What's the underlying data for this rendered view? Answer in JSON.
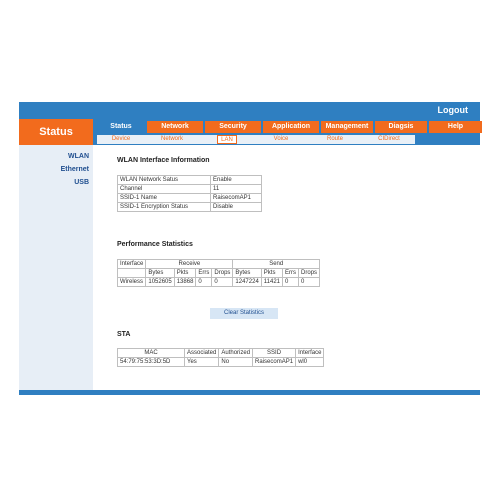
{
  "header": {
    "logout_label": "Logout",
    "status_label": "Status"
  },
  "nav": {
    "main": [
      "Status",
      "Network",
      "Security",
      "Application",
      "Management",
      "Diagsis",
      "Help"
    ],
    "sub": [
      "Device",
      "Network",
      "LAN",
      "Voice",
      "Route",
      "CIDirect"
    ]
  },
  "sidebar": {
    "items": [
      "WLAN",
      "Ethernet",
      "USB"
    ]
  },
  "wlan": {
    "title": "WLAN Interface Information",
    "rows": [
      {
        "label": "WLAN Network Satus",
        "value": "Enable"
      },
      {
        "label": "Channel",
        "value": "11"
      },
      {
        "label": "SSID-1 Name",
        "value": "RaisecomAP1"
      },
      {
        "label": "SSID-1 Encryption Status",
        "value": "Disable"
      }
    ]
  },
  "perf": {
    "title": "Performance Statistics",
    "headers": {
      "interface": "Interface",
      "receive": "Receive",
      "send": "Send"
    },
    "subheaders": [
      "Bytes",
      "Pkts",
      "Errs",
      "Drops",
      "Bytes",
      "Pkts",
      "Errs",
      "Drops"
    ],
    "row": {
      "interface": "Wireless",
      "values": [
        "1052605",
        "13868",
        "0",
        "0",
        "1247224",
        "11421",
        "0",
        "0"
      ]
    },
    "clear_label": "Clear Statistics"
  },
  "sta": {
    "title": "STA",
    "headers": [
      "MAC",
      "Associated",
      "Authorized",
      "SSID",
      "Interface"
    ],
    "row": [
      "54:79:75:53:3D:5D",
      "Yes",
      "No",
      "RaisecomAP1",
      "wl0"
    ]
  }
}
